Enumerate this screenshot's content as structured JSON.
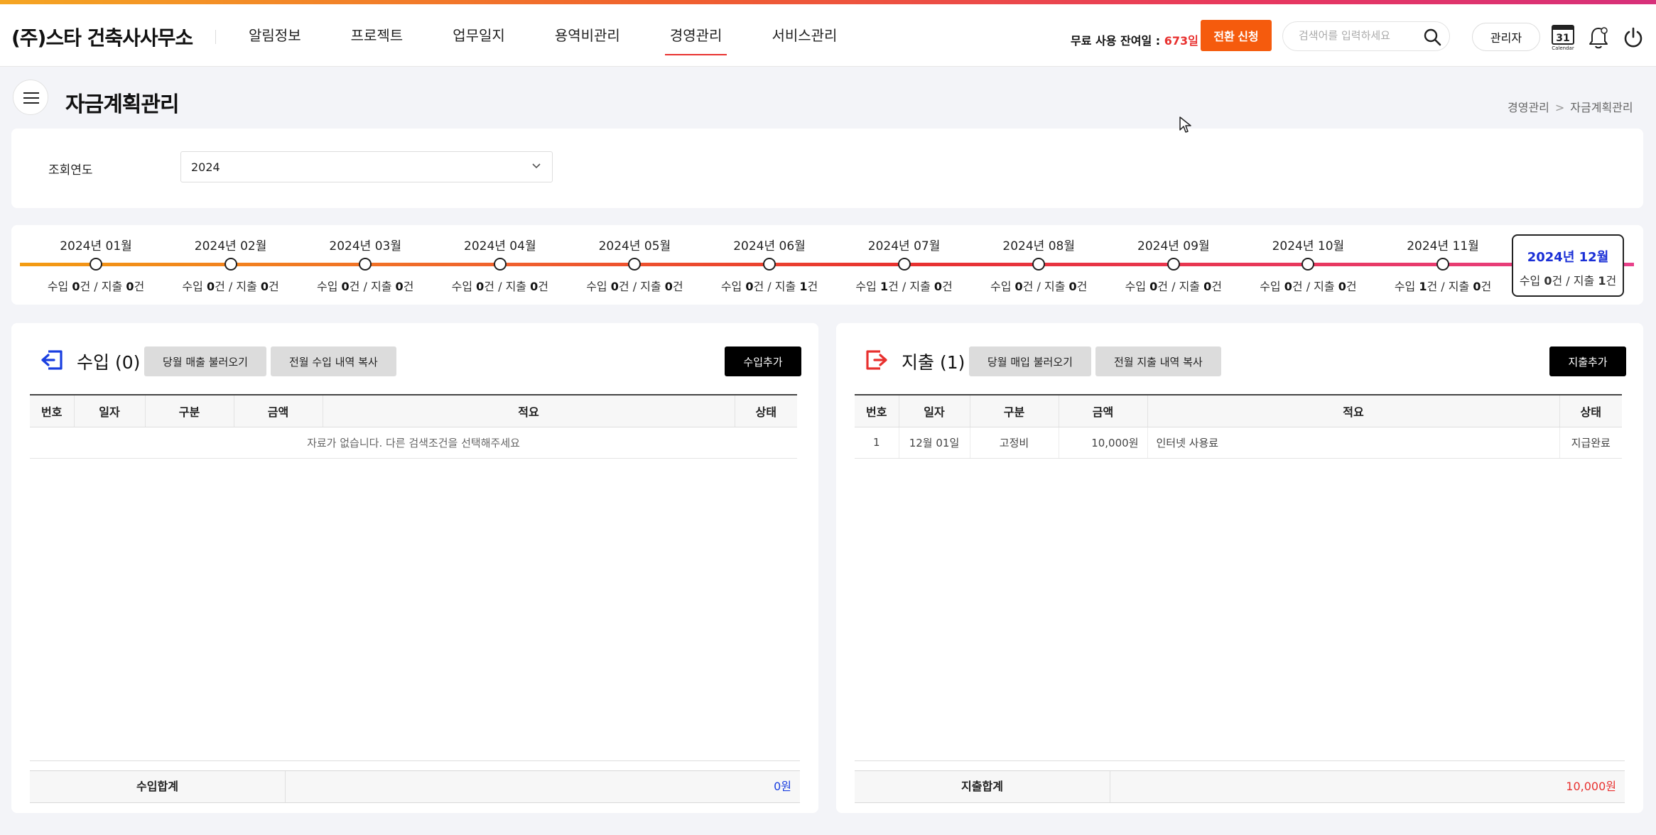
{
  "header": {
    "brand": "(주)스타 건축사사무소",
    "nav": [
      "알림정보",
      "프로젝트",
      "업무일지",
      "용역비관리",
      "경영관리",
      "서비스관리"
    ],
    "active_nav": "경영관리",
    "trial_label": "무료 사용 잔여일 : ",
    "trial_days": "673일",
    "convert_button": "전환 신청",
    "search_placeholder": "검색어를 입력하세요",
    "admin_button": "관리자",
    "calendar_day": "31",
    "calendar_label": "Calendar"
  },
  "page": {
    "title": "자금계획관리",
    "breadcrumb": [
      "경영관리",
      "자금계획관리"
    ]
  },
  "filter": {
    "label": "조회연도",
    "year": "2024"
  },
  "timeline": {
    "months": [
      {
        "label": "2024년 01월",
        "income": "0",
        "expense": "0"
      },
      {
        "label": "2024년 02월",
        "income": "0",
        "expense": "0"
      },
      {
        "label": "2024년 03월",
        "income": "0",
        "expense": "0"
      },
      {
        "label": "2024년 04월",
        "income": "0",
        "expense": "0"
      },
      {
        "label": "2024년 05월",
        "income": "0",
        "expense": "0"
      },
      {
        "label": "2024년 06월",
        "income": "0",
        "expense": "1"
      },
      {
        "label": "2024년 07월",
        "income": "1",
        "expense": "0"
      },
      {
        "label": "2024년 08월",
        "income": "0",
        "expense": "0"
      },
      {
        "label": "2024년 09월",
        "income": "0",
        "expense": "0"
      },
      {
        "label": "2024년 10월",
        "income": "0",
        "expense": "0"
      },
      {
        "label": "2024년 11월",
        "income": "1",
        "expense": "0"
      }
    ],
    "active": {
      "label": "2024년 12월",
      "income": "0",
      "expense": "1"
    },
    "income_prefix": "수입 ",
    "expense_prefix": " / 지출 ",
    "count_unit": "건"
  },
  "income_panel": {
    "title": "수입 (0)",
    "btn_load": "당월 매출 불러오기",
    "btn_copy": "전월 수입 내역 복사",
    "btn_add": "수입추가",
    "columns": [
      "번호",
      "일자",
      "구분",
      "금액",
      "적요",
      "상태"
    ],
    "empty_message": "자료가 없습니다. 다른 검색조건을 선택해주세요",
    "sum_label": "수입합계",
    "sum_value": "0원"
  },
  "expense_panel": {
    "title": "지출 (1)",
    "btn_load": "당월 매입 불러오기",
    "btn_copy": "전월 지출 내역 복사",
    "btn_add": "지출추가",
    "columns": [
      "번호",
      "일자",
      "구분",
      "금액",
      "적요",
      "상태"
    ],
    "rows": [
      {
        "no": "1",
        "date": "12월 01일",
        "type": "고정비",
        "amount": "10,000원",
        "memo": "인터넷 사용료",
        "status": "지급완료"
      }
    ],
    "sum_label": "지출합계",
    "sum_value": "10,000원"
  },
  "colors": {
    "accent": "#f55b0d",
    "active_nav_underline": "#e8312f",
    "income_total": "#1a3fe0",
    "expense_total": "#e8312f",
    "active_month": "#1a2fd6"
  }
}
